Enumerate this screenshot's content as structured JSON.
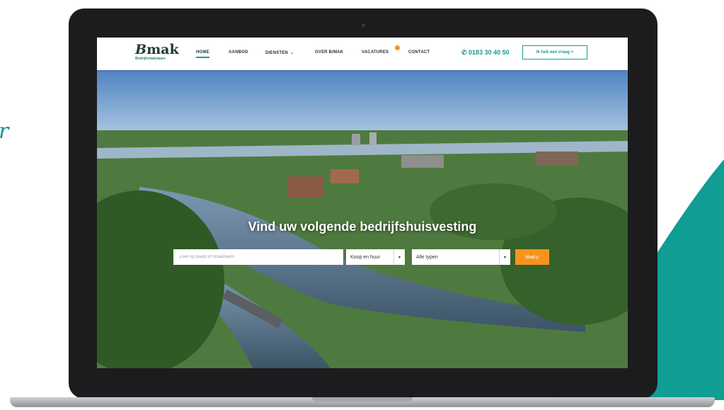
{
  "decor": {
    "script_text": "r",
    "teal": "#0f9d94"
  },
  "logo": {
    "main_b": "B",
    "main_rest": "mak",
    "sub": "Bedrijfsmakelaars"
  },
  "nav": {
    "items": [
      "HOME",
      "AANBOD",
      "DIENSTEN",
      "OVER B/MAK",
      "VACATURES",
      "CONTACT"
    ],
    "caret": "⌄",
    "phone": "0183 30 40 50",
    "phone_icon": "phone-icon",
    "cta_label": "Ik heb een vraag >"
  },
  "hero": {
    "headline": "Vind uw volgende bedrijfshuisvesting"
  },
  "search": {
    "placeholder": "Zoek op plaats of straatnaam",
    "type_select": "Koop en huur",
    "category_select": "Alle typen",
    "arrow": "▾",
    "button_label": "Vind ▷"
  },
  "colors": {
    "accent": "#1e9a8c",
    "cta_orange": "#f7941d",
    "brand_dark": "#1f3b2f"
  }
}
